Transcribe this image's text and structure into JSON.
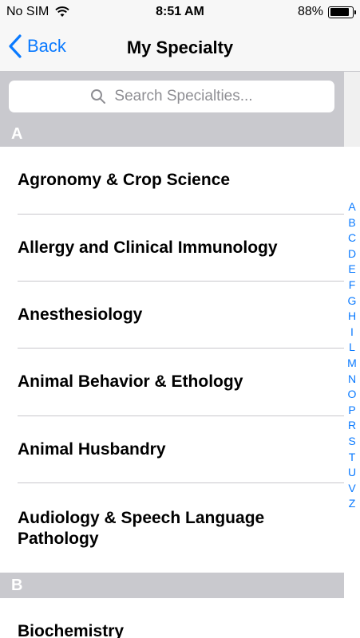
{
  "status": {
    "carrier": "No SIM",
    "time": "8:51 AM",
    "battery_text": "88%",
    "battery_level": 0.88
  },
  "nav": {
    "back_label": "Back",
    "title": "My Specialty"
  },
  "search": {
    "placeholder": "Search Specialties..."
  },
  "sections": [
    {
      "letter": "A",
      "items": [
        "Agronomy & Crop Science",
        "Allergy and Clinical Immunology",
        "Anesthesiology",
        "Animal Behavior & Ethology",
        "Animal Husbandry",
        "Audiology & Speech Language Pathology"
      ]
    },
    {
      "letter": "B",
      "items": [
        "Biochemistry"
      ]
    }
  ],
  "index": [
    "A",
    "B",
    "C",
    "D",
    "E",
    "F",
    "G",
    "H",
    "I",
    "L",
    "M",
    "N",
    "O",
    "P",
    "R",
    "S",
    "T",
    "U",
    "V",
    "Z"
  ],
  "colors": {
    "accent": "#0a7aff",
    "section_header_bg": "#c9c9ce"
  }
}
